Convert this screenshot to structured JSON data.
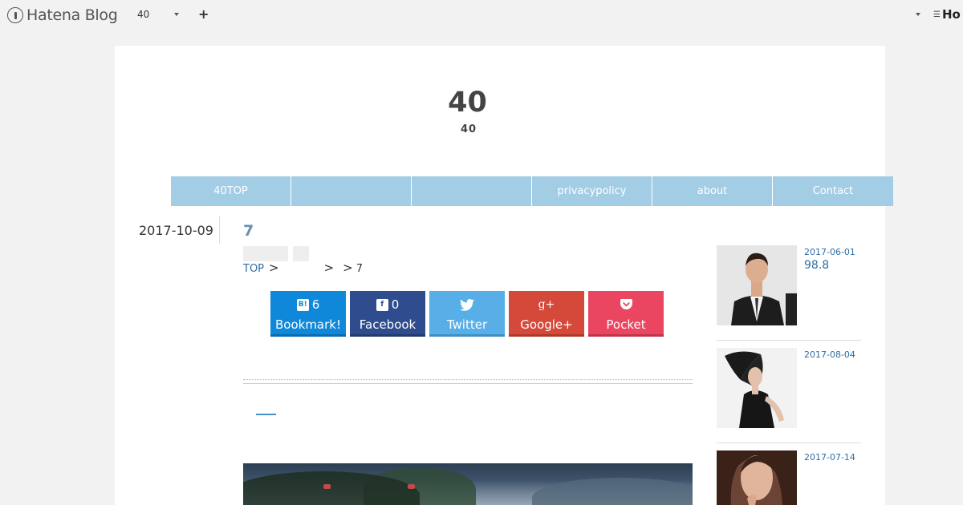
{
  "topbar": {
    "logo_text": "Hatena Blog",
    "blog_name": "40",
    "add_label": "+",
    "right_logo": "Ho"
  },
  "blog": {
    "title": "40",
    "description": "40"
  },
  "nav": {
    "items": [
      "40TOP",
      "",
      "",
      "privacypolicy",
      "about",
      "Contact"
    ]
  },
  "entry": {
    "date": "2017-10-09",
    "title": "7",
    "breadcrumb": {
      "top": "TOP",
      "sep": ">",
      "last": "7"
    }
  },
  "share": [
    {
      "icon": "hatena-bookmark-icon",
      "count": "6",
      "label": "Bookmark!"
    },
    {
      "icon": "facebook-icon",
      "count": "0",
      "label": "Facebook"
    },
    {
      "icon": "twitter-icon",
      "count": "",
      "label": "Twitter"
    },
    {
      "icon": "google-plus-icon",
      "count": "",
      "label": "Google+"
    },
    {
      "icon": "pocket-icon",
      "count": "",
      "label": "Pocket"
    }
  ],
  "sidebar": {
    "items": [
      {
        "date": "2017-06-01",
        "title": "98.8"
      },
      {
        "date": "2017-08-04",
        "title": ""
      },
      {
        "date": "2017-07-14",
        "title": ""
      }
    ]
  },
  "colors": {
    "nav_bg": "#a3cde5",
    "link": "#2e6da4",
    "entry_title": "#6b8fae"
  }
}
